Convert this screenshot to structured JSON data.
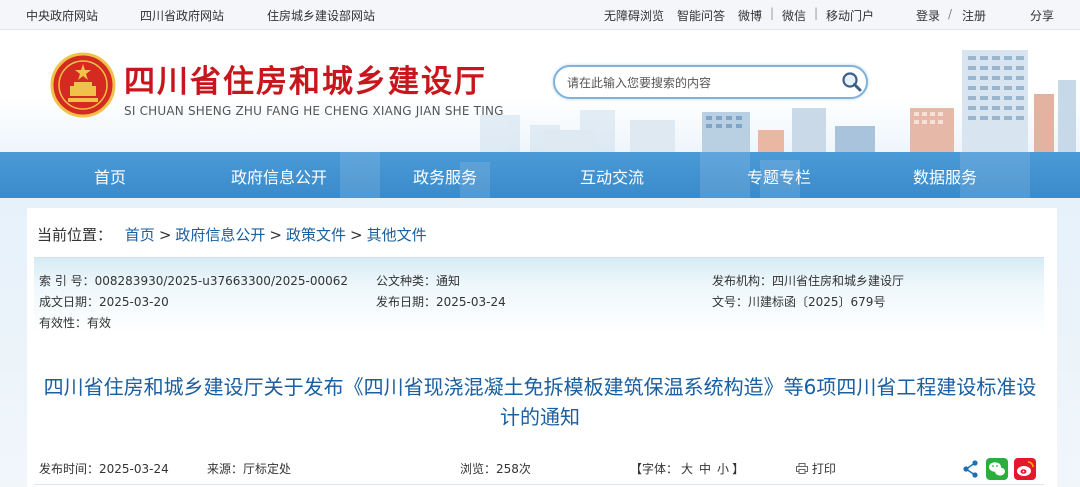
{
  "topbar": {
    "left_links": [
      "中央政府网站",
      "四川省政府网站",
      "住房城乡建设部网站"
    ],
    "right_links": [
      "无障碍浏览",
      "智能问答",
      "微博",
      "微信",
      "移动门户"
    ],
    "login": "登录",
    "slash": "/",
    "register": "注册",
    "share": "分享"
  },
  "header": {
    "title": "四川省住房和城乡建设厅",
    "subtitle": "SI CHUAN SHENG ZHU FANG HE CHENG XIANG JIAN SHE TING",
    "search_placeholder": "请在此输入您要搜索的内容"
  },
  "nav": {
    "items": [
      "首页",
      "政府信息公开",
      "政务服务",
      "互动交流",
      "专题专栏",
      "数据服务"
    ]
  },
  "breadcrumb": {
    "label": "当前位置：",
    "items": [
      "首页",
      "政府信息公开",
      "政策文件",
      "其他文件"
    ],
    "sep": ">"
  },
  "meta": {
    "index_no": "索 引 号：008283930/2025-u37663300/2025-00062",
    "doc_type": "公文种类：通知",
    "publisher": "发布机构：四川省住房和城乡建设厅",
    "created": "成文日期：2025-03-20",
    "published": "发布日期：2025-03-24",
    "doc_no": "文号：川建标函〔2025〕679号",
    "validity": "有效性：有效"
  },
  "document": {
    "title": "四川省住房和城乡建设厅关于发布《四川省现浇混凝土免拆模板建筑保温系统构造》等6项四川省工程建设标准设计的通知"
  },
  "info": {
    "pub_time": "发布时间：2025-03-24",
    "source": "来源：厅标定处",
    "views": "浏览：258次",
    "font_label": "【字体：",
    "font_large": "大",
    "font_medium": "中",
    "font_small": "小",
    "font_close": "】",
    "print": "打印"
  },
  "colors": {
    "brand_red": "#c8161d",
    "nav_blue": "#3f8fcf",
    "title_blue": "#1a5fa0",
    "wechat_green": "#2aae3e",
    "weibo_red": "#e6162d"
  }
}
